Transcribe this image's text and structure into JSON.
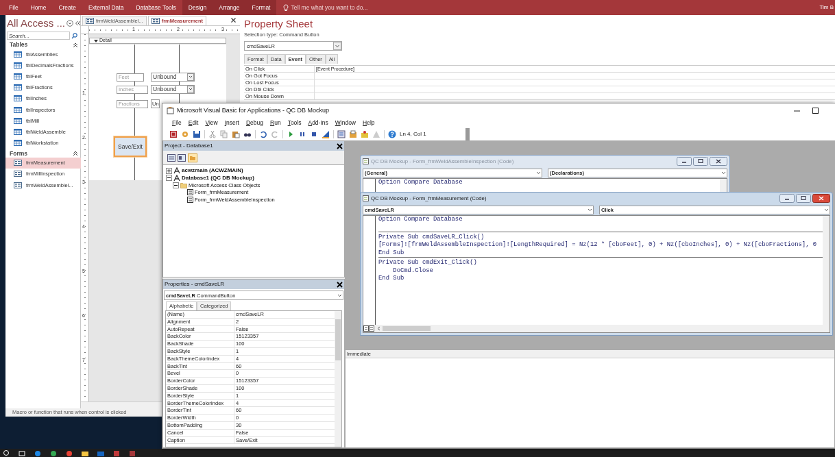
{
  "ribbon": {
    "tabs": [
      {
        "label": "File",
        "contextual": false
      },
      {
        "label": "Home",
        "contextual": false
      },
      {
        "label": "Create",
        "contextual": false
      },
      {
        "label": "External Data",
        "contextual": false
      },
      {
        "label": "Database Tools",
        "contextual": false
      },
      {
        "label": "Design",
        "contextual": true
      },
      {
        "label": "Arrange",
        "contextual": true
      },
      {
        "label": "Format",
        "contextual": true
      }
    ],
    "tell_me": {
      "placeholder": "Tell me what you want to do..."
    },
    "user": "Tim B"
  },
  "nav_pane": {
    "title": "All Access ...",
    "search": {
      "placeholder": "Search..."
    },
    "groups": [
      {
        "label": "Tables",
        "expanded": true,
        "items": [
          {
            "label": "tblAssemblies",
            "kind": "table",
            "selected": false
          },
          {
            "label": "tblDecimalsFractions",
            "kind": "table",
            "selected": false
          },
          {
            "label": "tblFeet",
            "kind": "table",
            "selected": false
          },
          {
            "label": "tblFractions",
            "kind": "table",
            "selected": false
          },
          {
            "label": "tblInches",
            "kind": "table",
            "selected": false
          },
          {
            "label": "tblInspectors",
            "kind": "table",
            "selected": false
          },
          {
            "label": "tblMill",
            "kind": "table",
            "selected": false
          },
          {
            "label": "tblWeldAssemble",
            "kind": "table",
            "selected": false
          },
          {
            "label": "tblWorkstation",
            "kind": "table",
            "selected": false
          }
        ]
      },
      {
        "label": "Forms",
        "expanded": true,
        "items": [
          {
            "label": "frmMeasurement",
            "kind": "form",
            "selected": true
          },
          {
            "label": "frmMillInspection",
            "kind": "form",
            "selected": false
          },
          {
            "label": "frmWeldAssemblel...",
            "kind": "form",
            "selected": false
          }
        ]
      }
    ]
  },
  "document_tabs": [
    {
      "label": "frmWeldAssemblel...",
      "selected": false
    },
    {
      "label": "frmMeasurement",
      "selected": true
    }
  ],
  "form_design": {
    "ruler_marks": [
      "1",
      "2",
      "3"
    ],
    "vertical_ruler_marks": [
      "1",
      "2",
      "3",
      "4",
      "5",
      "6",
      "7"
    ],
    "section": "Detail",
    "fields": [
      {
        "label": "Feet",
        "combo": "Unbound"
      },
      {
        "label": "Inches",
        "combo": "Unbound"
      },
      {
        "label": "Fractions",
        "combo": "Un"
      }
    ],
    "button": {
      "caption": "Save/Exit",
      "selected": true
    }
  },
  "property_sheet": {
    "title": "Property Sheet",
    "selection_type": "Selection type:  Command Button",
    "object": "cmdSaveLR",
    "tabs": [
      {
        "label": "Format",
        "selected": false
      },
      {
        "label": "Data",
        "selected": false
      },
      {
        "label": "Event",
        "selected": true
      },
      {
        "label": "Other",
        "selected": false
      },
      {
        "label": "All",
        "selected": false
      }
    ],
    "rows": [
      {
        "name": "On Click",
        "value": "[Event Procedure]"
      },
      {
        "name": "On Got Focus"
      },
      {
        "name": "On Lost Focus"
      },
      {
        "name": "On Dbl Click"
      },
      {
        "name": "On Mouse Down"
      }
    ]
  },
  "status_bar": "Macro or function that runs when control is clicked",
  "vba": {
    "title": "Microsoft Visual Basic for Applications - QC DB Mockup",
    "menu": [
      "File",
      "Edit",
      "View",
      "Insert",
      "Debug",
      "Run",
      "Tools",
      "Add-Ins",
      "Window",
      "Help"
    ],
    "position": "Ln 4, Col 1",
    "project": {
      "title": "Project - Database1",
      "tree": [
        {
          "label": "acwzmain (ACWZMAIN)",
          "expanded": false
        },
        {
          "label": "Database1 (QC DB Mockup)",
          "expanded": true,
          "children": [
            {
              "label": "Microsoft Access Class Objects",
              "expanded": true,
              "children": [
                {
                  "label": "Form_frmMeasurement"
                },
                {
                  "label": "Form_frmWeldAssembleInspection"
                }
              ]
            }
          ]
        }
      ]
    },
    "properties": {
      "title": "Properties - cmdSaveLR",
      "object": "cmdSaveLR",
      "object_type": "CommandButton",
      "tabs": [
        {
          "label": "Alphabetic",
          "selected": true
        },
        {
          "label": "Categorized",
          "selected": false
        }
      ],
      "rows": [
        {
          "name": "(Name)",
          "value": "cmdSaveLR"
        },
        {
          "name": "Alignment",
          "value": "2"
        },
        {
          "name": "AutoRepeat",
          "value": "False"
        },
        {
          "name": "BackColor",
          "value": "15123357"
        },
        {
          "name": "BackShade",
          "value": "100"
        },
        {
          "name": "BackStyle",
          "value": "1"
        },
        {
          "name": "BackThemeColorIndex",
          "value": "4"
        },
        {
          "name": "BackTint",
          "value": "60"
        },
        {
          "name": "Bevel",
          "value": "0"
        },
        {
          "name": "BorderColor",
          "value": "15123357"
        },
        {
          "name": "BorderShade",
          "value": "100"
        },
        {
          "name": "BorderStyle",
          "value": "1"
        },
        {
          "name": "BorderThemeColorIndex",
          "value": "4"
        },
        {
          "name": "BorderTint",
          "value": "60"
        },
        {
          "name": "BorderWidth",
          "value": "0"
        },
        {
          "name": "BottomPadding",
          "value": "30"
        },
        {
          "name": "Cancel",
          "value": "False"
        },
        {
          "name": "Caption",
          "value": "Save/Exit"
        }
      ]
    },
    "code_windows": [
      {
        "title": "QC DB Mockup - Form_frmWeldAssembleInspection (Code)",
        "active": false,
        "object": "(General)",
        "procedure": "(Declarations)",
        "blocks": [
          [
            "Option Compare Database"
          ]
        ]
      },
      {
        "title": "QC DB Mockup - Form_frmMeasurement (Code)",
        "active": true,
        "object": "cmdSaveLR",
        "procedure": "Click",
        "blocks": [
          [
            "Option Compare Database"
          ],
          [
            "Private Sub cmdSaveLR_Click()",
            "[Forms]![frmWeldAssembleInspection]![LengthRequired] = Nz(12 * [cboFeet], 0) + Nz([cboInches], 0) + Nz([cboFractions], 0",
            "End Sub"
          ],
          [
            "Private Sub cmdExit_Click()",
            "    DoCmd.Close",
            "End Sub"
          ]
        ]
      }
    ],
    "immediate": {
      "title": "Immediate"
    }
  }
}
